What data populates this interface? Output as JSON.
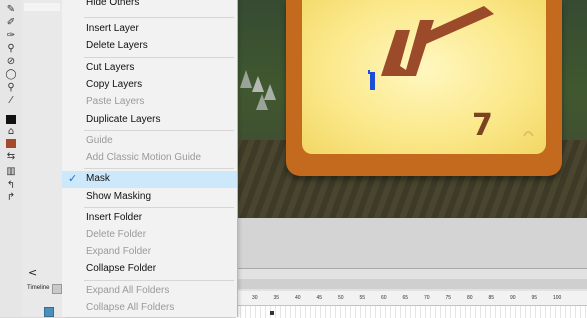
{
  "toolbar": {
    "tools": [
      "pen-tool",
      "pencil-tool",
      "brush-tool",
      "ink-bottle-tool",
      "paint-bucket-tool",
      "eyedropper-tool",
      "eraser-tool",
      "lasso-tool",
      "zoom-tool",
      "hand-tool"
    ],
    "stroke_color": "#111111",
    "fill_color": "#a24a2a"
  },
  "panel": {
    "collapse_label": "<",
    "timeline_label": "Timeline"
  },
  "stage": {
    "digit": "7",
    "board_color": "#c36a1f",
    "board_inner_color": "#fbe98c"
  },
  "timeline": {
    "ticks": [
      "30",
      "35",
      "40",
      "45",
      "50",
      "55",
      "60",
      "65",
      "70",
      "75",
      "80",
      "85",
      "90",
      "95",
      "100"
    ]
  },
  "menu": {
    "hide_others": "Hide Others",
    "insert_layer": "Insert Layer",
    "delete_layers": "Delete Layers",
    "cut_layers": "Cut Layers",
    "copy_layers": "Copy Layers",
    "paste_layers": "Paste Layers",
    "duplicate_layers": "Duplicate Layers",
    "guide": "Guide",
    "add_classic_motion_guide": "Add Classic Motion Guide",
    "mask": "Mask",
    "show_masking": "Show Masking",
    "insert_folder": "Insert Folder",
    "delete_folder": "Delete Folder",
    "expand_folder": "Expand Folder",
    "collapse_folder": "Collapse Folder",
    "expand_all_folders": "Expand All Folders",
    "collapse_all_folders": "Collapse All Folders",
    "check_mark": "✓"
  }
}
